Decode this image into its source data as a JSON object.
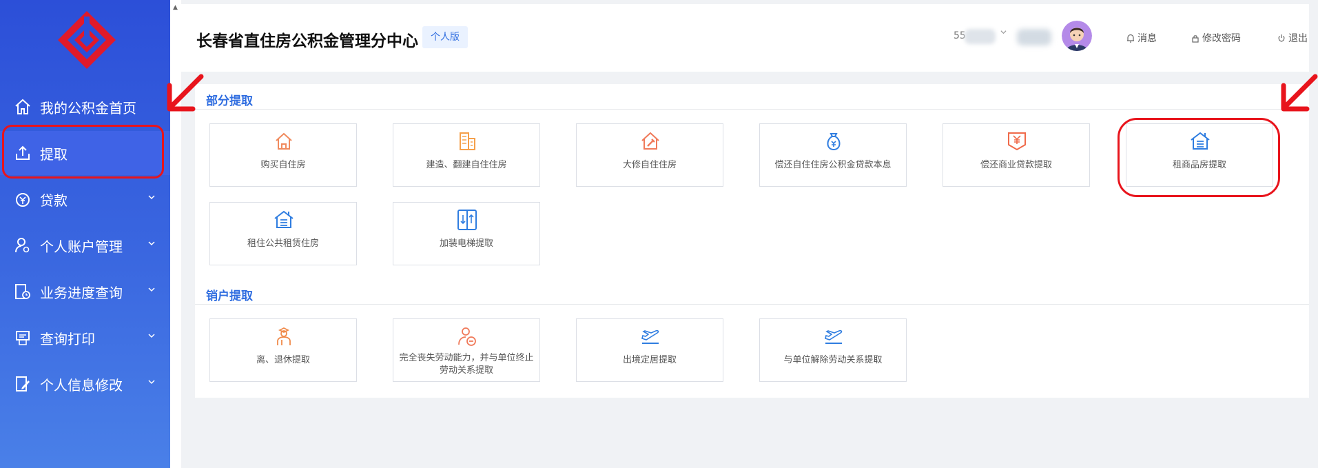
{
  "app": {
    "title": "长春省直住房公积金管理分中心",
    "badge": "个人版"
  },
  "sidebar": {
    "items": [
      {
        "label": "我的公积金首页",
        "icon": "home-icon",
        "has_submenu": false,
        "active": false
      },
      {
        "label": "提取",
        "icon": "upload-icon",
        "has_submenu": false,
        "active": true
      },
      {
        "label": "贷款",
        "icon": "yuan-bag-icon",
        "has_submenu": true,
        "active": false
      },
      {
        "label": "个人账户管理",
        "icon": "user-settings-icon",
        "has_submenu": true,
        "active": false
      },
      {
        "label": "业务进度查询",
        "icon": "progress-clock-icon",
        "has_submenu": true,
        "active": false
      },
      {
        "label": "查询打印",
        "icon": "printer-icon",
        "has_submenu": true,
        "active": false
      },
      {
        "label": "个人信息修改",
        "icon": "edit-profile-icon",
        "has_submenu": true,
        "active": false
      }
    ]
  },
  "header": {
    "user_prefix": "55",
    "messages": "消息",
    "change_password": "修改密码",
    "logout": "退出"
  },
  "sections": [
    {
      "title": "部分提取",
      "cards": [
        {
          "label": "购买自住房",
          "icon": "house-icon",
          "color": "#f08a5d"
        },
        {
          "label": "建造、翻建自住住房",
          "icon": "building-icon",
          "color": "#f5a04a"
        },
        {
          "label": "大修自住住房",
          "icon": "house-repair-icon",
          "color": "#f07a5a"
        },
        {
          "label": "偿还自住住房公积金贷款本息",
          "icon": "money-bag-icon",
          "color": "#2f7de0"
        },
        {
          "label": "偿还商业贷款提取",
          "icon": "yuan-ticket-icon",
          "color": "#f06a4a"
        },
        {
          "label": "租商品房提取",
          "icon": "rent-house-icon",
          "color": "#2f7de0"
        },
        {
          "label": "租住公共租赁住房",
          "icon": "rent-house-icon",
          "color": "#2f7de0"
        },
        {
          "label": "加装电梯提取",
          "icon": "elevator-icon",
          "color": "#2f7de0"
        }
      ]
    },
    {
      "title": "销户提取",
      "cards": [
        {
          "label": "离、退休提取",
          "icon": "retiree-icon",
          "color": "#f08a4a"
        },
        {
          "label": "完全丧失劳动能力，并与单位终止劳动关系提取",
          "icon": "disability-icon",
          "color": "#f07a5a"
        },
        {
          "label": "出境定居提取",
          "icon": "airplane-icon",
          "color": "#2f7de0"
        },
        {
          "label": "与单位解除劳动关系提取",
          "icon": "airplane-icon",
          "color": "#2f7de0"
        }
      ]
    }
  ],
  "colors": {
    "sidebar": "#2c4fd8",
    "accent": "#2f6de0",
    "annotation": "#e8141c",
    "logo": "#e01a2a"
  }
}
